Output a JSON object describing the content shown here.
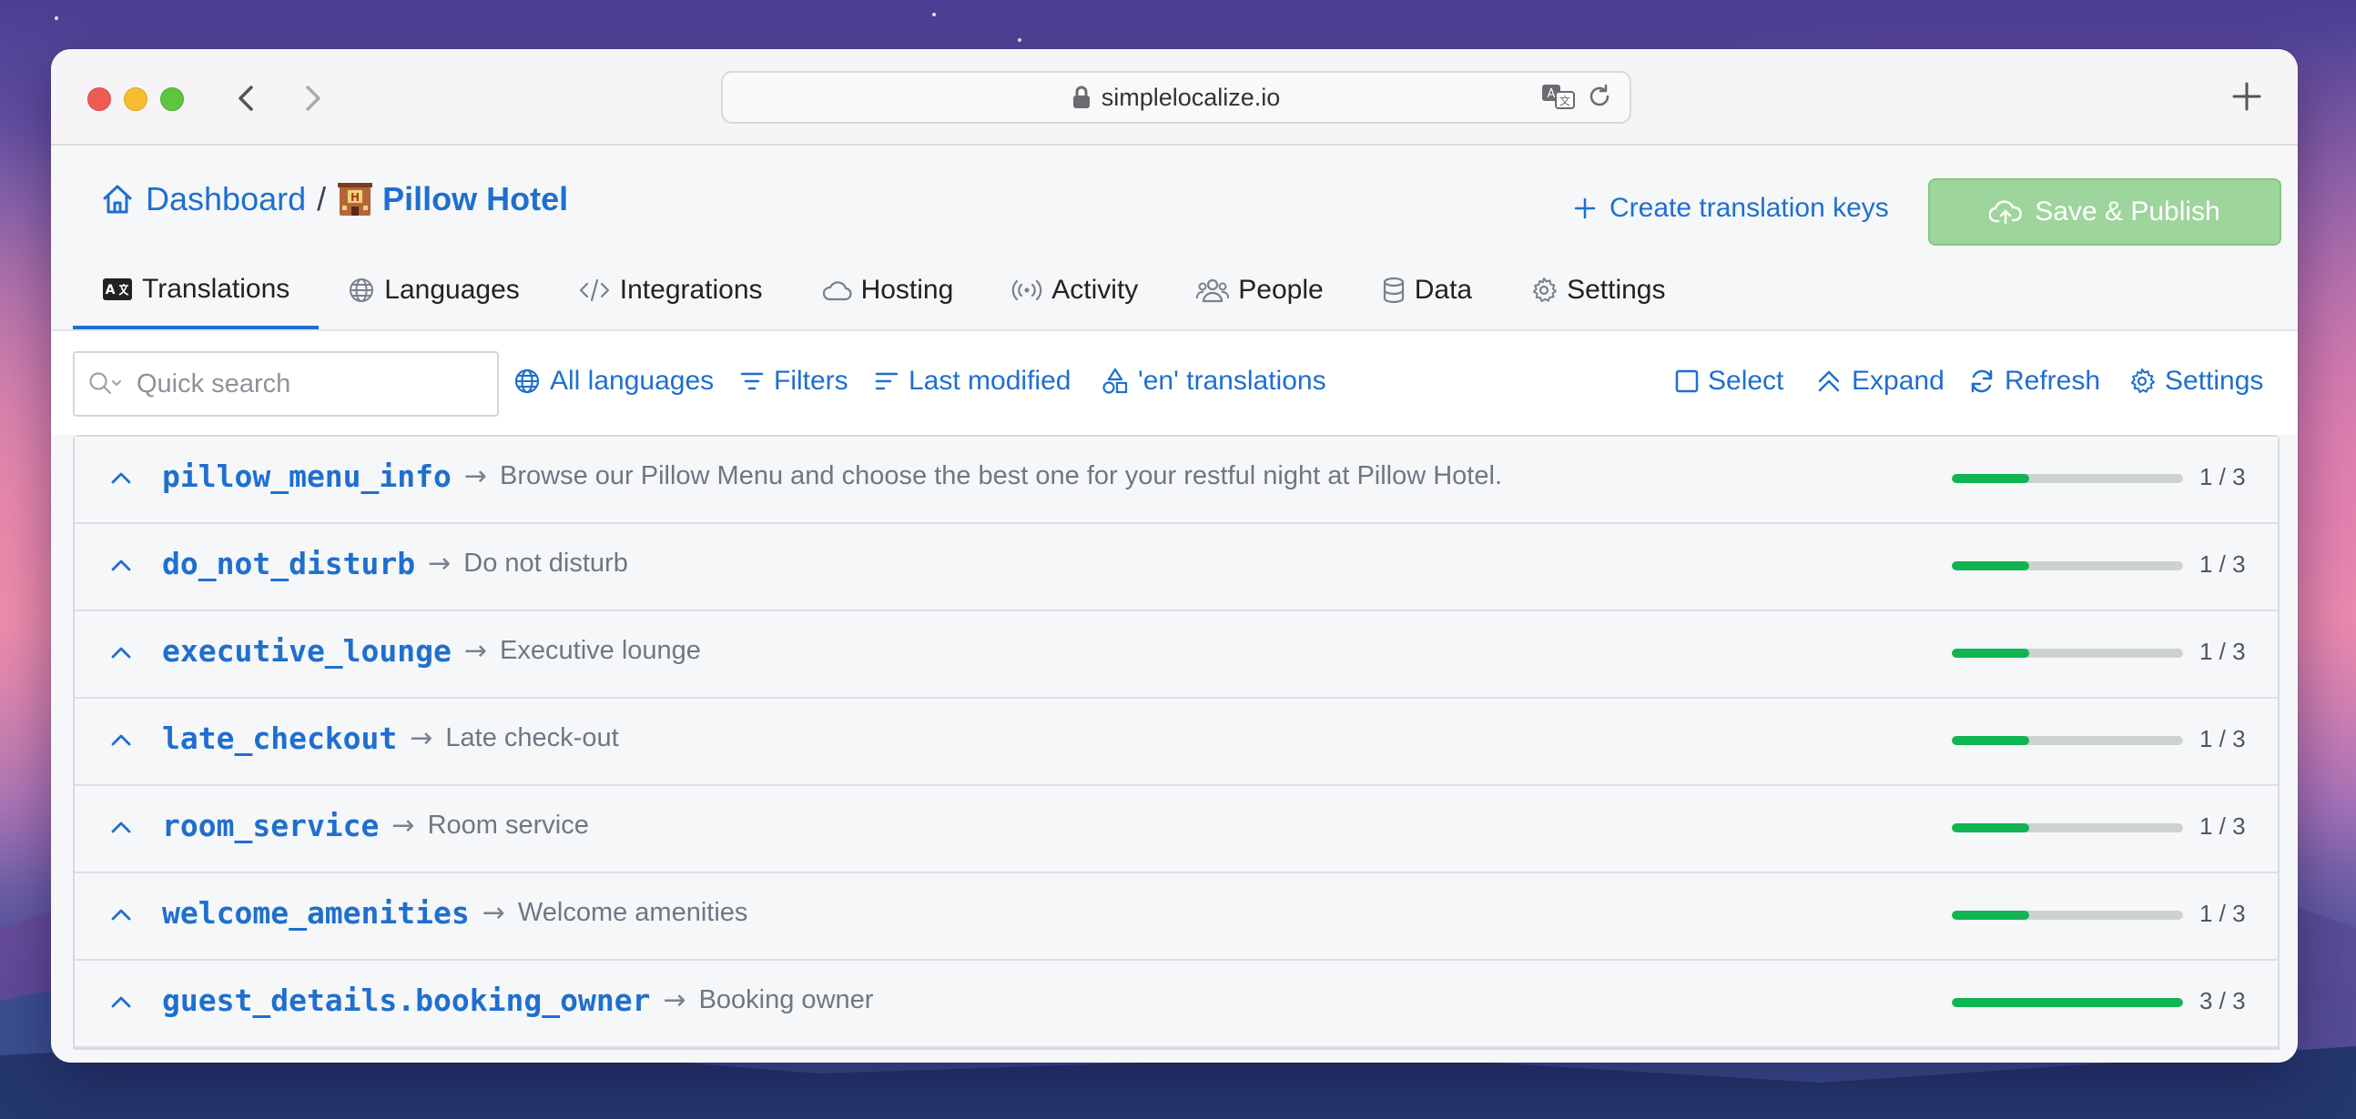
{
  "browser": {
    "url": "simplelocalize.io"
  },
  "header": {
    "breadcrumb_home": "Dashboard",
    "breadcrumb_sep": "/",
    "project_name": "Pillow Hotel",
    "create_keys_label": "Create translation keys",
    "save_publish_label": "Save & Publish"
  },
  "tabs": [
    {
      "label": "Translations",
      "icon": "translate-icon",
      "active": true
    },
    {
      "label": "Languages",
      "icon": "globe-icon"
    },
    {
      "label": "Integrations",
      "icon": "code-icon"
    },
    {
      "label": "Hosting",
      "icon": "cloud-icon"
    },
    {
      "label": "Activity",
      "icon": "broadcast-icon"
    },
    {
      "label": "People",
      "icon": "people-icon"
    },
    {
      "label": "Data",
      "icon": "database-icon"
    },
    {
      "label": "Settings",
      "icon": "gear-icon"
    }
  ],
  "toolbar": {
    "search_placeholder": "Quick search",
    "all_languages": "All languages",
    "filters": "Filters",
    "last_modified": "Last modified",
    "en_translations": "'en' translations",
    "select": "Select",
    "expand": "Expand",
    "refresh": "Refresh",
    "settings": "Settings"
  },
  "rows": [
    {
      "key": "pillow_menu_info",
      "value": "Browse our Pillow Menu and choose the best one for your restful night at Pillow Hotel.",
      "count": "1 / 3",
      "progress": 0.333
    },
    {
      "key": "do_not_disturb",
      "value": "Do not disturb",
      "count": "1 / 3",
      "progress": 0.333
    },
    {
      "key": "executive_lounge",
      "value": "Executive lounge",
      "count": "1 / 3",
      "progress": 0.333
    },
    {
      "key": "late_checkout",
      "value": "Late check-out",
      "count": "1 / 3",
      "progress": 0.333
    },
    {
      "key": "room_service",
      "value": "Room service",
      "count": "1 / 3",
      "progress": 0.333
    },
    {
      "key": "welcome_amenities",
      "value": "Welcome amenities",
      "count": "1 / 3",
      "progress": 0.333
    },
    {
      "key": "guest_details.booking_owner",
      "value": "Booking owner",
      "count": "3 / 3",
      "progress": 1.0
    }
  ],
  "colors": {
    "accent": "#1f6fcf",
    "progress_fill": "#10b552",
    "save_button": "#9ed59c"
  }
}
